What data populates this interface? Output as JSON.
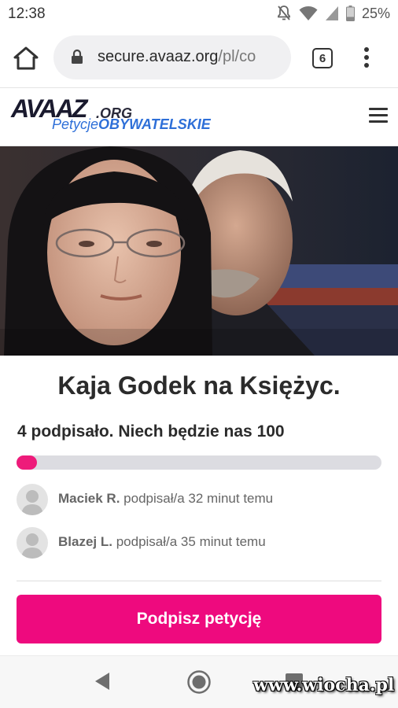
{
  "status_bar": {
    "time": "12:38",
    "battery": "25%",
    "icons": [
      "notifications-off-icon",
      "wifi-icon",
      "signal-icon",
      "battery-icon"
    ]
  },
  "browser": {
    "url_host": "secure.avaaz.org",
    "url_path": "/pl/co",
    "tab_count": "6",
    "icons": [
      "home-icon",
      "lock-icon",
      "tabs-icon",
      "more-vert-icon"
    ]
  },
  "site": {
    "logo_main": "AVAAZ",
    "logo_org": ".ORG",
    "logo_sub_1": "Petycje",
    "logo_sub_2": "OBYWATELSKIE"
  },
  "petition": {
    "title": "Kaja Godek na Księżyc.",
    "goal_text": "4 podpisało. Niech będzie nas 100",
    "progress_fraction": 0.04,
    "accent_color": "#ee0a7e",
    "signers": [
      {
        "name": "Maciek R.",
        "action": "podpisał/a 32 minut temu"
      },
      {
        "name": "Blazej L.",
        "action": "podpisał/a 35 minut temu"
      }
    ],
    "sign_button": "Podpisz petycję"
  },
  "watermark": "www.wiocha.pl"
}
